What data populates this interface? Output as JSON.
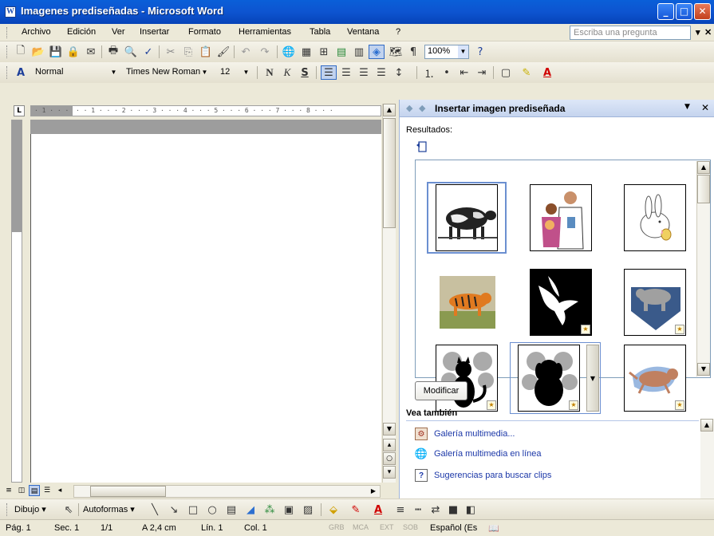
{
  "window": {
    "title": "Imagenes prediseñadas - Microsoft Word",
    "app_icon": "W"
  },
  "menubar": {
    "items": [
      "Archivo",
      "Edición",
      "Ver",
      "Insertar",
      "Formato",
      "Herramientas",
      "Tabla",
      "Ventana",
      "?"
    ],
    "ask_placeholder": "Escriba una pregunta"
  },
  "toolbar_format": {
    "style": "Normal",
    "font": "Times New Roman",
    "size": "12"
  },
  "toolbar_standard": {
    "zoom": "100%"
  },
  "taskpane": {
    "title": "Insertar imagen prediseñada",
    "results_label": "Resultados:",
    "modify_button": "Modificar",
    "see_also_title": "Vea también",
    "links": [
      "Galería multimedia...",
      "Galería multimedia en línea",
      "Sugerencias para buscar clips"
    ],
    "clips": [
      "cow",
      "doctor-family",
      "rabbit",
      "tiger",
      "dove",
      "bear-arrow",
      "cat-silhouette",
      "dog-silhouette",
      "cat-jumping"
    ]
  },
  "drawbar": {
    "draw_label": "Dibujo",
    "autoshapes_label": "Autoformas"
  },
  "status": {
    "page": "Pág. 1",
    "section": "Sec. 1",
    "pages": "1/1",
    "position": "A 2,4 cm",
    "line": "Lín. 1",
    "column": "Col. 1",
    "grb": "GRB",
    "mca": "MCA",
    "ext": "EXT",
    "sob": "SOB",
    "language": "Español (Es"
  }
}
